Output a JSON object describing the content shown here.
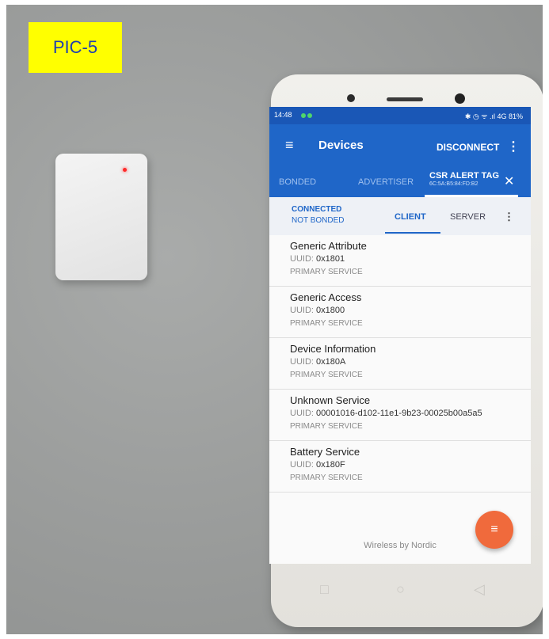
{
  "label": "PIC-5",
  "phone": {
    "status": {
      "time": "14:48",
      "right": "✱ ◷ ᯤ .ıl 4G 81%"
    },
    "appbar": {
      "menu": "≡",
      "title": "Devices",
      "disconnect": "DISCONNECT",
      "more": "⋮"
    },
    "tabs": {
      "bonded": "BONDED",
      "advertiser": "ADVERTISER",
      "device": "CSR ALERT TAG",
      "mac": "6C:5A:B5:84:FD:B2",
      "close": "✕"
    },
    "connection": {
      "state": "CONNECTED",
      "bond": "NOT BONDED",
      "client": "CLIENT",
      "server": "SERVER",
      "more": "⋮"
    },
    "uuid_label": "UUID:",
    "services": [
      {
        "name": "Generic Attribute",
        "uuid": "0x1801",
        "type": "PRIMARY SERVICE"
      },
      {
        "name": "Generic Access",
        "uuid": "0x1800",
        "type": "PRIMARY SERVICE"
      },
      {
        "name": "Device Information",
        "uuid": "0x180A",
        "type": "PRIMARY SERVICE"
      },
      {
        "name": "Unknown Service",
        "uuid": "00001016-d102-11e1-9b23-00025b00a5a5",
        "type": "PRIMARY SERVICE"
      },
      {
        "name": "Battery Service",
        "uuid": "0x180F",
        "type": "PRIMARY SERVICE"
      }
    ],
    "fab_icon": "≡",
    "footer": "Wireless by Nordic"
  },
  "colors": {
    "primary": "#1f66c8",
    "fab": "#f06a3c",
    "label_bg": "#ffff00",
    "label_text": "#1f3fb0"
  }
}
